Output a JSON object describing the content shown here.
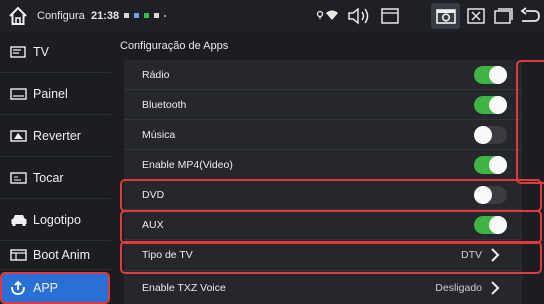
{
  "statusbar": {
    "title": "Configura",
    "time": "21:38"
  },
  "sidebar": {
    "items": [
      {
        "label": "TV",
        "icon": "tv-icon"
      },
      {
        "label": "Painel",
        "icon": "panel-icon"
      },
      {
        "label": "Reverter",
        "icon": "reverse-camera-icon"
      },
      {
        "label": "Tocar",
        "icon": "touch-icon"
      },
      {
        "label": "Logotipo",
        "icon": "car-logo-icon"
      },
      {
        "label": "Boot Anim",
        "icon": "boot-animation-icon"
      },
      {
        "label": "APP",
        "icon": "app-icon",
        "active": true
      }
    ]
  },
  "main": {
    "section_title": "Configuração de Apps",
    "rows": [
      {
        "label": "Rádio",
        "type": "toggle",
        "on": true
      },
      {
        "label": "Bluetooth",
        "type": "toggle",
        "on": true
      },
      {
        "label": "Música",
        "type": "toggle",
        "on": false
      },
      {
        "label": "Enable MP4(Video)",
        "type": "toggle",
        "on": true
      },
      {
        "label": "DVD",
        "type": "toggle",
        "on": false
      },
      {
        "label": "AUX",
        "type": "toggle",
        "on": true
      },
      {
        "label": "Tipo de TV",
        "type": "select",
        "value": "DTV"
      },
      {
        "label": "Enable TXZ Voice",
        "type": "select",
        "value": "Desligado"
      }
    ]
  },
  "colors": {
    "accent": "#2a6fd6",
    "toggle_on": "#3fb442",
    "highlight": "#e23a3a"
  }
}
